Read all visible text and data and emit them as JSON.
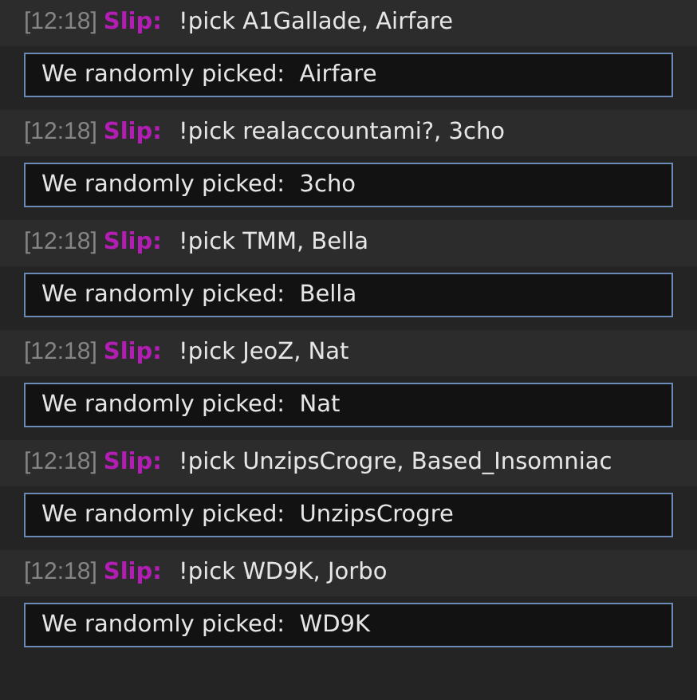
{
  "messages": [
    {
      "time": "[12:18]",
      "user": "Slip:",
      "text": "!pick A1Gallade, Airfare",
      "reply": "We randomly picked:  Airfare"
    },
    {
      "time": "[12:18]",
      "user": "Slip:",
      "text": "!pick realaccountami?, 3cho",
      "reply": "We randomly picked:  3cho"
    },
    {
      "time": "[12:18]",
      "user": "Slip:",
      "text": "!pick TMM, Bella",
      "reply": "We randomly picked:  Bella"
    },
    {
      "time": "[12:18]",
      "user": "Slip:",
      "text": "!pick JeoZ, Nat",
      "reply": "We randomly picked:  Nat"
    },
    {
      "time": "[12:18]",
      "user": "Slip:",
      "text": "!pick UnzipsCrogre, Based_Insomniac",
      "reply": "We randomly picked:  UnzipsCrogre"
    },
    {
      "time": "[12:18]",
      "user": "Slip:",
      "text": "!pick WD9K, Jorbo",
      "reply": "We randomly picked:  WD9K"
    }
  ]
}
